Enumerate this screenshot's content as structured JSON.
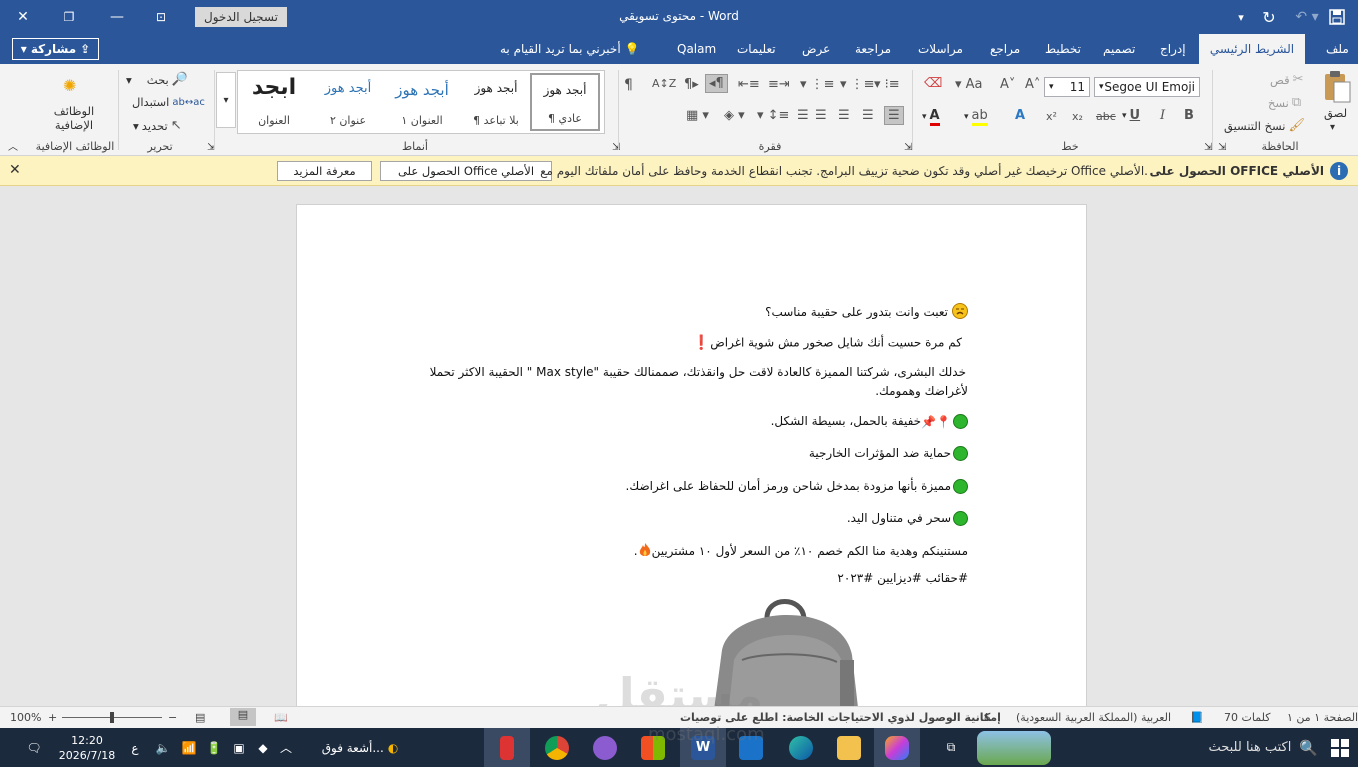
{
  "window": {
    "title": "محتوى تسويقي  -  Word",
    "signin_label": "تسجيل الدخول"
  },
  "tabs": {
    "items": [
      "ملف",
      "الشريط الرئيسي",
      "إدراج",
      "تصميم",
      "تخطيط",
      "مراجع",
      "مراسلات",
      "مراجعة",
      "عرض",
      "تعليمات",
      "Qalam"
    ],
    "tellme": "أخبرني بما تريد القيام به",
    "share": "مشاركة"
  },
  "ribbon": {
    "clipboard": {
      "label": "الحافظة",
      "paste": "لصق",
      "cut": "قص",
      "copy": "نسخ",
      "format_painter": "نسخ التنسيق"
    },
    "font": {
      "label": "خط",
      "name": "Segoe UI Emoji",
      "size": "11"
    },
    "paragraph": {
      "label": "فقرة"
    },
    "styles": {
      "label": "أنماط",
      "items": [
        {
          "sample": "أبجد هوز",
          "name": "¶ عادي"
        },
        {
          "sample": "أبجد هوز",
          "name": "¶ بلا تباعد"
        },
        {
          "sample": "أبجد هوز",
          "name": "العنوان ١"
        },
        {
          "sample": "أبجد هوز",
          "name": "عنوان ٢"
        },
        {
          "sample": "ابجد",
          "name": "العنوان"
        }
      ]
    },
    "editing": {
      "label": "تحرير",
      "find": "بحث",
      "replace": "استبدال",
      "select": "تحديد"
    },
    "addins": {
      "label": "الوظائف الإضافية",
      "button": "الوظائف الإضافية"
    }
  },
  "infobar": {
    "title": "الحصول على OFFICE الأصلي",
    "message": "ترخيصك غير أصلي وقد تكون ضحية تزييف البرامج. تجنب انقطاع الخدمة وحافظ على أمان ملفاتك اليوم مع Office الأصلي.",
    "get_genuine": "الحصول على Office الأصلي",
    "learn_more": "معرفة المزيد"
  },
  "document": {
    "lines": [
      "تعبت وانت بتدور على حقيبة مناسب؟",
      "كم مرة حسيت أنك شايل صخور مش شوية اغراض",
      "خدلك البشرى، شركتنا المميزة كالعادة لاقت حل وانقذتك، صممنالك حقيبة \"Max style \" الحقيبة الاكثر تحملا",
      "لأغراضك وهمومك.",
      "خفيفة بالحمل، بسيطة الشكل.",
      "حماية ضد المؤثرات الخارجية",
      "مميزة بأنها مزودة بمدخل شاحن ورمز أمان للحفاظ على اغراضك.",
      "سحر في متناول اليد.",
      "مستنينكم وهدية منا الكم خصم ١٠٪ من السعر لأول ١٠ مشتريين",
      "#حقائب #ديزايين #٢٠٢٣"
    ]
  },
  "statusbar": {
    "page": "الصفحة ١ من ١",
    "words": "70 كلمات",
    "language": "العربية (المملكة العربية السعودية)",
    "accessibility": "إمكانية الوصول لذوي الاحتياجات الخاصة: اطلع على توصيات",
    "zoom": "100%"
  },
  "taskbar": {
    "search_placeholder": "اكتب هنا للبحث",
    "weather": "أشعة فوق...",
    "time": "12:20",
    "date": "2026/7/18",
    "lang": "ع"
  },
  "watermark": {
    "text": "مستقل",
    "site": "mostaql.com"
  },
  "colors": {
    "accent": "#2b579a",
    "infobar": "#fdf3c0",
    "taskbar": "#1c2a3e"
  }
}
